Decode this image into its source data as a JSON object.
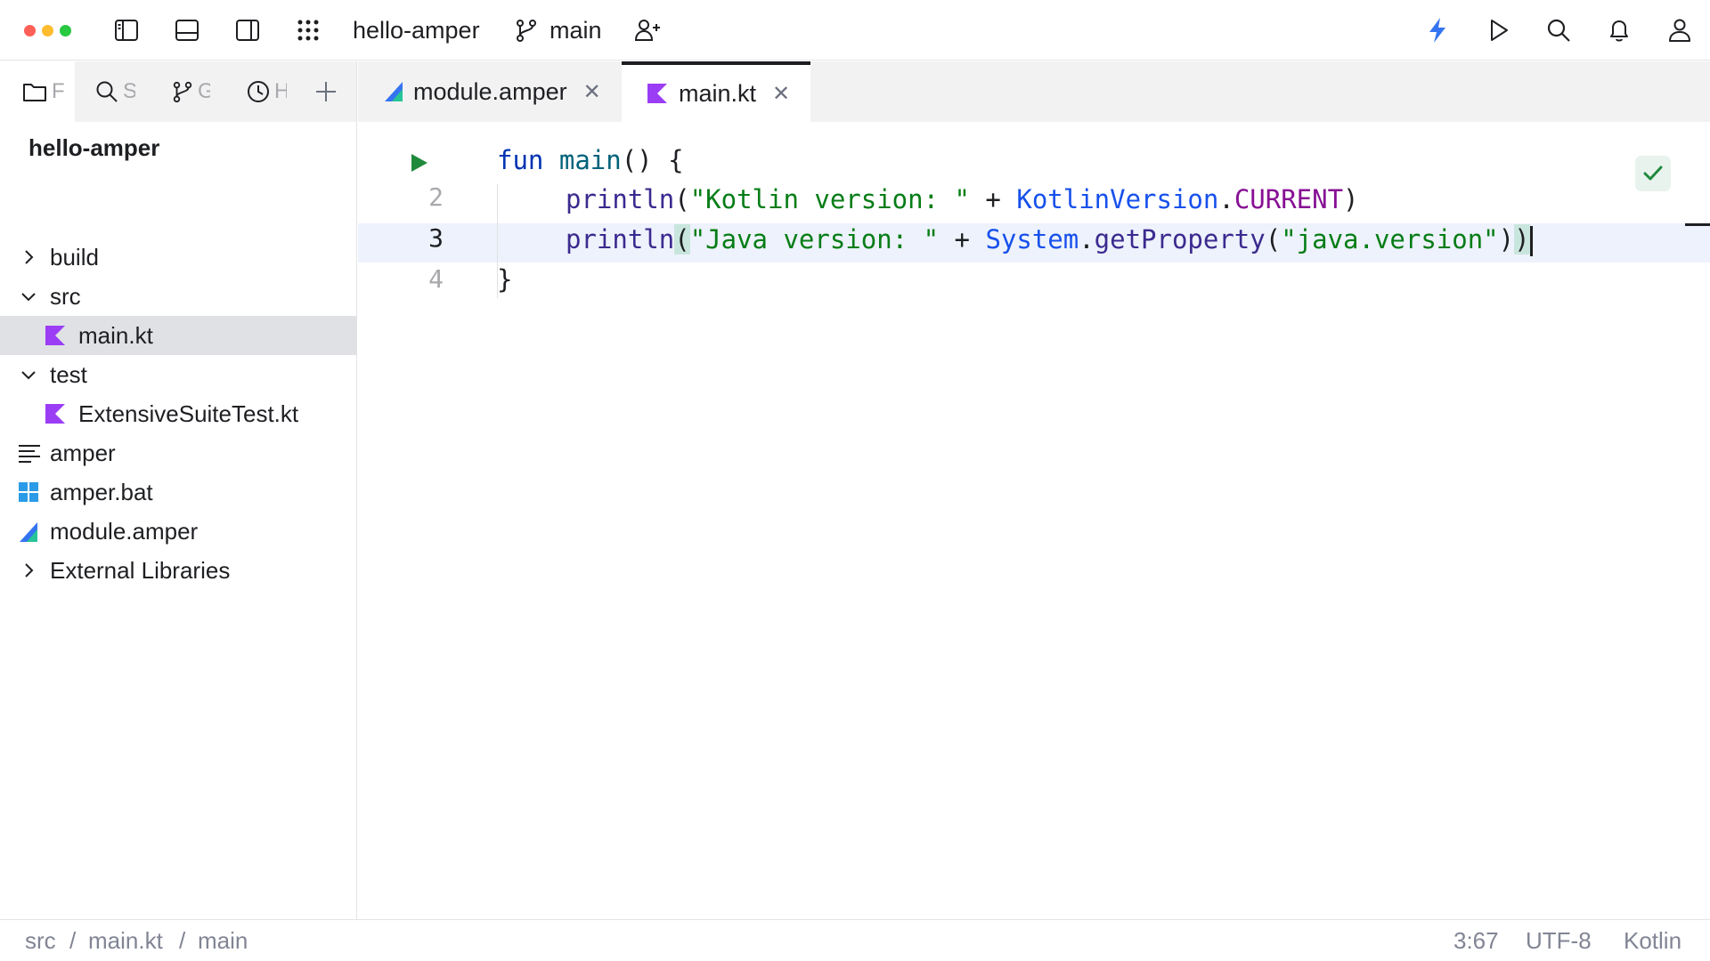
{
  "colors": {
    "traffic_red": "#ff5f57",
    "traffic_yellow": "#febc2e",
    "traffic_green": "#28c840",
    "accent_blue": "#3574f0",
    "kotlin_purple": "#9b3df5",
    "check_green": "#208a3c"
  },
  "titlebar": {
    "project_name": "hello-amper",
    "branch": "main",
    "icons": [
      "toggle-left-panel-icon",
      "toggle-bottom-panel-icon",
      "toggle-right-panel-icon",
      "apps-grid-icon",
      "branch-icon",
      "add-user-icon",
      "lightning-icon",
      "run-icon",
      "search-icon",
      "bell-icon",
      "profile-icon"
    ]
  },
  "left_panel": {
    "tabs": [
      {
        "icon": "folder-icon",
        "label": "F"
      },
      {
        "icon": "search-icon",
        "label": "S"
      },
      {
        "icon": "branch-icon",
        "label": "G"
      },
      {
        "icon": "clock-icon",
        "label": "H"
      }
    ],
    "project_title": "hello-amper",
    "tree": [
      {
        "label": "build",
        "expand": "collapsed",
        "icon": "none"
      },
      {
        "label": "src",
        "expand": "expanded",
        "icon": "none"
      },
      {
        "label": "main.kt",
        "expand": "none",
        "icon": "kotlin-file-icon",
        "selected": true
      },
      {
        "label": "test",
        "expand": "expanded",
        "icon": "none"
      },
      {
        "label": "ExtensiveSuiteTest.kt",
        "expand": "none",
        "icon": "kotlin-file-icon"
      },
      {
        "label": "amper",
        "expand": "none",
        "icon": "text-file-icon"
      },
      {
        "label": "amper.bat",
        "expand": "none",
        "icon": "windows-icon"
      },
      {
        "label": "module.amper",
        "expand": "none",
        "icon": "amper-icon"
      },
      {
        "label": "External Libraries",
        "expand": "collapsed",
        "icon": "none"
      }
    ]
  },
  "editor_tabs": [
    {
      "label": "module.amper",
      "icon": "amper-icon",
      "active": false
    },
    {
      "label": "main.kt",
      "icon": "kotlin-file-icon",
      "active": true
    }
  ],
  "editor": {
    "line_numbers": [
      "2",
      "3",
      "4"
    ],
    "current_line": "3",
    "code": {
      "l1_kw": "fun",
      "l1_name": "main",
      "l1_rest": "() {",
      "l2_call": "println",
      "l2_open": "(",
      "l2_str": "\"Kotlin version: \"",
      "l2_plus": " + ",
      "l2_cls": "KotlinVersion",
      "l2_dot": ".",
      "l2_const": "CURRENT",
      "l2_close": ")",
      "l3_call": "println",
      "l3_open": "(",
      "l3_str": "\"Java version: \"",
      "l3_plus": " + ",
      "l3_cls": "System",
      "l3_dot": ".",
      "l3_method": "getProperty",
      "l3_open2": "(",
      "l3_str2": "\"java.version\"",
      "l3_close2": ")",
      "l3_close": ")",
      "l4": "}"
    }
  },
  "statusbar": {
    "breadcrumb": [
      "src",
      "main.kt",
      "main"
    ],
    "separator": "/",
    "position": "3:67",
    "encoding": "UTF-8",
    "language": "Kotlin"
  }
}
